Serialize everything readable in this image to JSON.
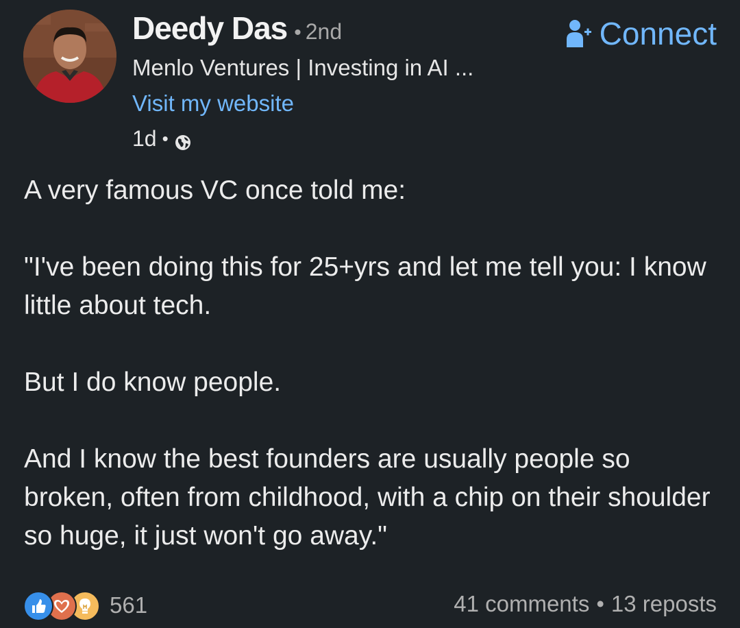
{
  "author": {
    "name": "Deedy Das",
    "degree": "2nd",
    "headline": "Menlo Ventures | Investing in AI ...",
    "website_label": "Visit my website",
    "posted_age": "1d",
    "visibility_icon": "globe-icon",
    "avatar_icon": "profile-photo"
  },
  "actions": {
    "connect_label": "Connect",
    "connect_icon": "add-person-icon"
  },
  "post": {
    "paragraphs": [
      "A very famous VC once told me:",
      "\"I've been doing this for 25+yrs and let me tell you: I know little about tech.",
      "But I do know people.",
      "And I know the best founders are usually people so broken, often from childhood, with a chip on their shoulder so huge, it just won't go away.\""
    ]
  },
  "social": {
    "reaction_icons": [
      "like-icon",
      "love-icon",
      "insightful-icon"
    ],
    "reaction_count": "561",
    "comments": "41 comments",
    "reposts": "13 reposts",
    "separator": "•"
  },
  "colors": {
    "background": "#1d2226",
    "link": "#71b7fb",
    "like": "#378fe9",
    "love": "#df704d",
    "insightful": "#f5bb5c"
  }
}
